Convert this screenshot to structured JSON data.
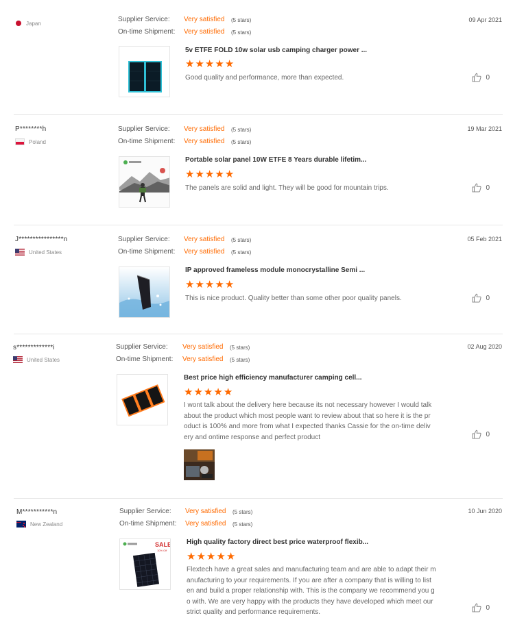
{
  "labels": {
    "supplier_service": "Supplier Service:",
    "on_time_shipment": "On-time Shipment:",
    "very_satisfied": "Very satisfied",
    "five_stars": "(5 stars)"
  },
  "reviews": [
    {
      "user": "",
      "country": "Japan",
      "flag": "jp",
      "date": "09 Apr 2021",
      "product_title": "5v ETFE FOLD 10w solar usb camping charger power ...",
      "rating": 5,
      "text": "Good quality and performance, more than expected.",
      "likes": "0"
    },
    {
      "user": "P********h",
      "country": "Poland",
      "flag": "pl",
      "date": "19 Mar 2021",
      "product_title": "Portable solar panel 10W ETFE 8 Years durable lifetim...",
      "rating": 5,
      "text": "The panels are solid and light. They will be good for mountain trips.",
      "likes": "0"
    },
    {
      "user": "J****************n",
      "country": "United States",
      "flag": "us",
      "date": "05 Feb 2021",
      "product_title": "IP approved frameless module monocrystalline Semi ...",
      "rating": 5,
      "text": "This is nice product. Quality better than some other poor quality panels.",
      "likes": "0"
    },
    {
      "user": "s*************i",
      "country": "United States",
      "flag": "us",
      "date": "02 Aug 2020",
      "product_title": "Best price high efficiency manufacturer camping cell...",
      "rating": 5,
      "text_lines": [
        "I wont talk about the delivery here because its not necessary however I would talk",
        "about the product which most people want to review about that so here it is the pr",
        "oduct is 100% and more from what I expected thanks Cassie for the on-time deliv",
        "ery and ontime response and perfect product"
      ],
      "likes": "0"
    },
    {
      "user": "M***********n",
      "country": "New Zealand",
      "flag": "nz",
      "date": "10 Jun 2020",
      "product_title": "High quality factory direct best price waterproof flexib...",
      "rating": 5,
      "text_lines": [
        "Flextech have a great sales and manufacturing team and are able to adapt their m",
        "anufacturing to your requirements. If you are after a company that is willing to list",
        "en and build a proper relationship with. This is the company we recommend you g",
        "o with. We are very happy with the products they have developed which meet our",
        "strict quality and performance requirements."
      ],
      "thumb_badge": "SALE",
      "thumb_badge_sub": "10% Off",
      "likes": "0"
    }
  ],
  "colors": {
    "accent": "#ff6a00",
    "divider": "#e6e6e6"
  },
  "icons": {
    "like": "thumbs-up-icon"
  }
}
